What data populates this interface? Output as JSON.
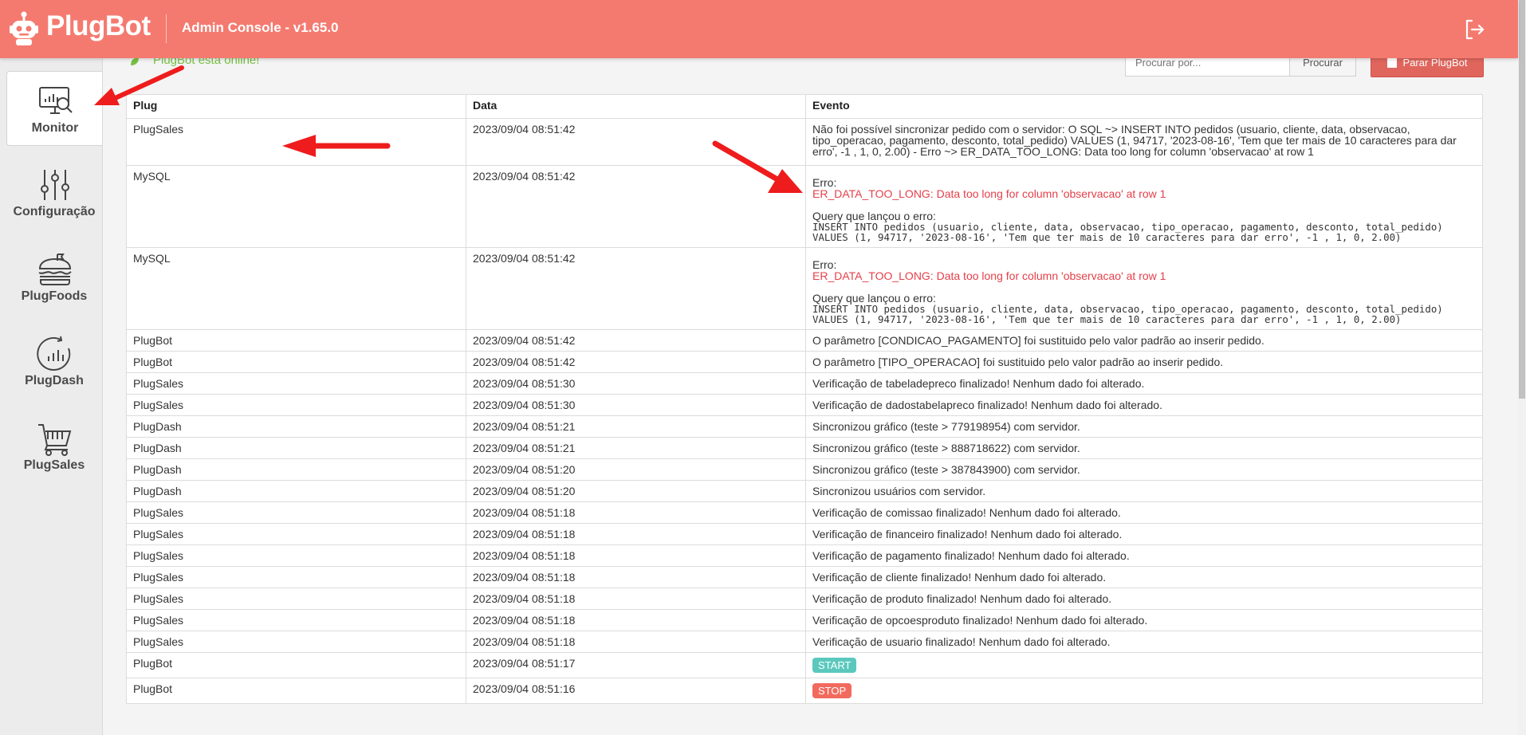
{
  "header": {
    "brand": "PlugBot",
    "console": "Admin Console - v1.65.0"
  },
  "sidebar": {
    "items": [
      {
        "label": "Monitor",
        "icon": "monitor-icon"
      },
      {
        "label": "Configuração",
        "icon": "sliders-icon"
      },
      {
        "label": "PlugFoods",
        "icon": "burger-icon"
      },
      {
        "label": "PlugDash",
        "icon": "dashboard-chart-icon"
      },
      {
        "label": "PlugSales",
        "icon": "cart-icon"
      }
    ]
  },
  "status": {
    "text": "PlugBot está online!"
  },
  "search": {
    "placeholder": "Procurar por...",
    "button": "Procurar"
  },
  "stop_button": "Parar PlugBot",
  "table": {
    "headers": [
      "Plug",
      "Data",
      "Evento"
    ],
    "rows": [
      {
        "plug": "PlugSales",
        "date": "2023/09/04 08:51:42",
        "event": "Não foi possível sincronizar pedido com o servidor: O SQL ~> INSERT INTO pedidos (usuario, cliente, data, observacao, tipo_operacao, pagamento, desconto, total_pedido) VALUES (1, 94717, '2023-08-16', 'Tem que ter mais de 10 caracteres para dar erro', -1 , 1, 0, 2.00) - Erro ~> ER_DATA_TOO_LONG: Data too long for column 'observacao' at row 1"
      },
      {
        "plug": "MySQL",
        "date": "2023/09/04 08:51:42",
        "error_label": "Erro:",
        "error_msg": "ER_DATA_TOO_LONG: Data too long for column 'observacao' at row 1",
        "query_label": "Query que lançou o erro:",
        "query_l1": "INSERT INTO pedidos (usuario, cliente, data, observacao, tipo_operacao, pagamento, desconto, total_pedido)",
        "query_l2": "VALUES (1, 94717, '2023-08-16', 'Tem que ter mais de 10 caracteres para dar erro', -1 , 1, 0, 2.00)"
      },
      {
        "plug": "MySQL",
        "date": "2023/09/04 08:51:42",
        "error_label": "Erro:",
        "error_msg": "ER_DATA_TOO_LONG: Data too long for column 'observacao' at row 1",
        "query_label": "Query que lançou o erro:",
        "query_l1": "INSERT INTO pedidos (usuario, cliente, data, observacao, tipo_operacao, pagamento, desconto, total_pedido)",
        "query_l2": "VALUES (1, 94717, '2023-08-16', 'Tem que ter mais de 10 caracteres para dar erro', -1 , 1, 0, 2.00)"
      },
      {
        "plug": "PlugBot",
        "date": "2023/09/04 08:51:42",
        "event": "O parâmetro [CONDICAO_PAGAMENTO] foi sustituido pelo valor padrão ao inserir pedido."
      },
      {
        "plug": "PlugBot",
        "date": "2023/09/04 08:51:42",
        "event": "O parâmetro [TIPO_OPERACAO] foi sustituido pelo valor padrão ao inserir pedido."
      },
      {
        "plug": "PlugSales",
        "date": "2023/09/04 08:51:30",
        "event": "Verificação de tabeladepreco finalizado! Nenhum dado foi alterado."
      },
      {
        "plug": "PlugSales",
        "date": "2023/09/04 08:51:30",
        "event": "Verificação de dadostabelapreco finalizado! Nenhum dado foi alterado."
      },
      {
        "plug": "PlugDash",
        "date": "2023/09/04 08:51:21",
        "event": "Sincronizou gráfico (teste > 779198954) com servidor."
      },
      {
        "plug": "PlugDash",
        "date": "2023/09/04 08:51:21",
        "event": "Sincronizou gráfico (teste > 888718622) com servidor."
      },
      {
        "plug": "PlugDash",
        "date": "2023/09/04 08:51:20",
        "event": "Sincronizou gráfico (teste > 387843900) com servidor."
      },
      {
        "plug": "PlugDash",
        "date": "2023/09/04 08:51:20",
        "event": "Sincronizou usuários com servidor."
      },
      {
        "plug": "PlugSales",
        "date": "2023/09/04 08:51:18",
        "event": "Verificação de comissao finalizado! Nenhum dado foi alterado."
      },
      {
        "plug": "PlugSales",
        "date": "2023/09/04 08:51:18",
        "event": "Verificação de financeiro finalizado! Nenhum dado foi alterado."
      },
      {
        "plug": "PlugSales",
        "date": "2023/09/04 08:51:18",
        "event": "Verificação de pagamento finalizado! Nenhum dado foi alterado."
      },
      {
        "plug": "PlugSales",
        "date": "2023/09/04 08:51:18",
        "event": "Verificação de cliente finalizado! Nenhum dado foi alterado."
      },
      {
        "plug": "PlugSales",
        "date": "2023/09/04 08:51:18",
        "event": "Verificação de produto finalizado! Nenhum dado foi alterado."
      },
      {
        "plug": "PlugSales",
        "date": "2023/09/04 08:51:18",
        "event": "Verificação de opcoesproduto finalizado! Nenhum dado foi alterado."
      },
      {
        "plug": "PlugSales",
        "date": "2023/09/04 08:51:18",
        "event": "Verificação de usuario finalizado! Nenhum dado foi alterado."
      },
      {
        "plug": "PlugBot",
        "date": "2023/09/04 08:51:17",
        "badge": "START"
      },
      {
        "plug": "PlugBot",
        "date": "2023/09/04 08:51:16",
        "badge": "STOP"
      }
    ]
  },
  "colors": {
    "header": "#f47a70",
    "online": "#77c043",
    "error": "#e5404a",
    "start_badge": "#5bc8bd",
    "stop_badge": "#f26a5e",
    "annotation_arrow": "#ee1c1c"
  }
}
